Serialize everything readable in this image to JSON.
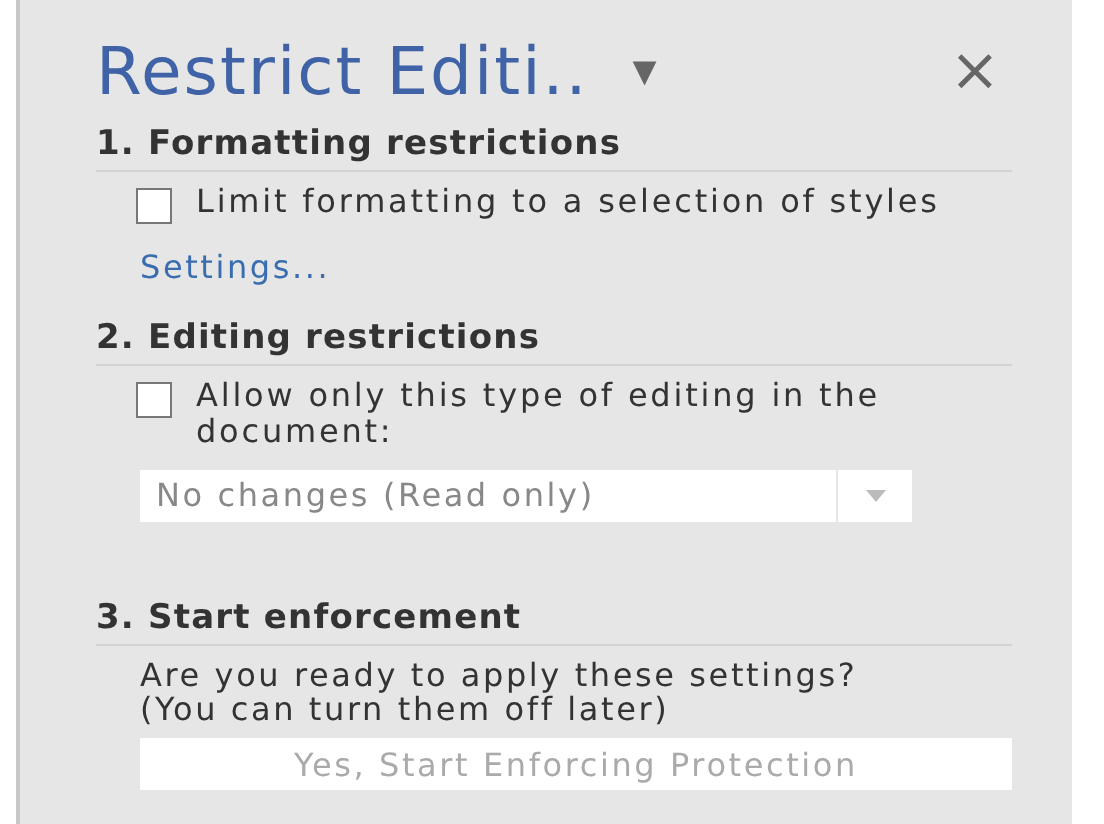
{
  "pane": {
    "title": "Restrict Editi..",
    "menu_caret": "▾",
    "close": "×"
  },
  "sections": [
    {
      "heading": "1. Formatting restrictions",
      "kind": "formatting",
      "checkbox": {
        "label": "Limit formatting to a selection of styles",
        "checked": false
      },
      "link": "Settings..."
    },
    {
      "heading": "2. Editing restrictions",
      "kind": "editing",
      "checkbox": {
        "label": "Allow only this type of editing in the document:",
        "checked": false
      },
      "dropdown": {
        "value": "No changes (Read only)",
        "disabled": true
      }
    },
    {
      "heading": "3. Start enforcement",
      "kind": "enforcement",
      "text": "Are you ready to apply these settings? (You can turn them off later)",
      "button": {
        "label": "Yes, Start Enforcing Protection",
        "disabled": true
      }
    }
  ]
}
